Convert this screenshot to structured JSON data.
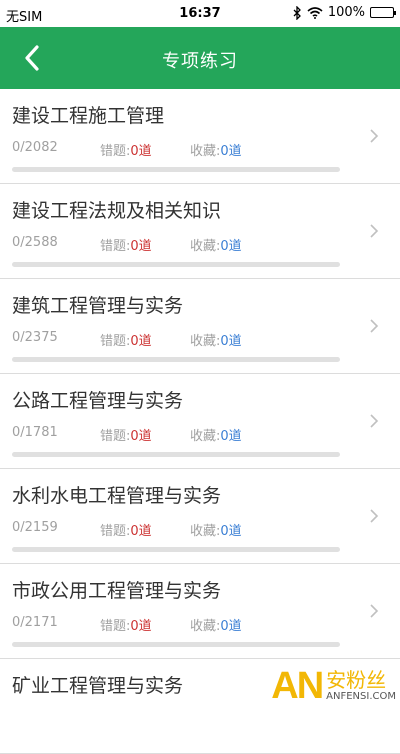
{
  "statusbar": {
    "carrier": "无SIM",
    "time": "16:37",
    "battery": "100%"
  },
  "navbar": {
    "title": "专项练习",
    "back_icon": "chevron-left-icon"
  },
  "labels": {
    "wrong": "错题:",
    "fav": "收藏:"
  },
  "items": [
    {
      "title": "建设工程施工管理",
      "progress": "0/2082",
      "wrong": "0道",
      "fav": "0道"
    },
    {
      "title": "建设工程法规及相关知识",
      "progress": "0/2588",
      "wrong": "0道",
      "fav": "0道"
    },
    {
      "title": "建筑工程管理与实务",
      "progress": "0/2375",
      "wrong": "0道",
      "fav": "0道"
    },
    {
      "title": "公路工程管理与实务",
      "progress": "0/1781",
      "wrong": "0道",
      "fav": "0道"
    },
    {
      "title": "水利水电工程管理与实务",
      "progress": "0/2159",
      "wrong": "0道",
      "fav": "0道"
    },
    {
      "title": "市政公用工程管理与实务",
      "progress": "0/2171",
      "wrong": "0道",
      "fav": "0道"
    },
    {
      "title": "矿业工程管理与实务"
    }
  ],
  "watermark": {
    "logo": "AN",
    "cn": "安粉丝",
    "en": "ANFENSI.COM"
  },
  "colors": {
    "primary": "#24a65a",
    "wrong_value": "#cc3333",
    "fav_value": "#3b7fd4"
  }
}
